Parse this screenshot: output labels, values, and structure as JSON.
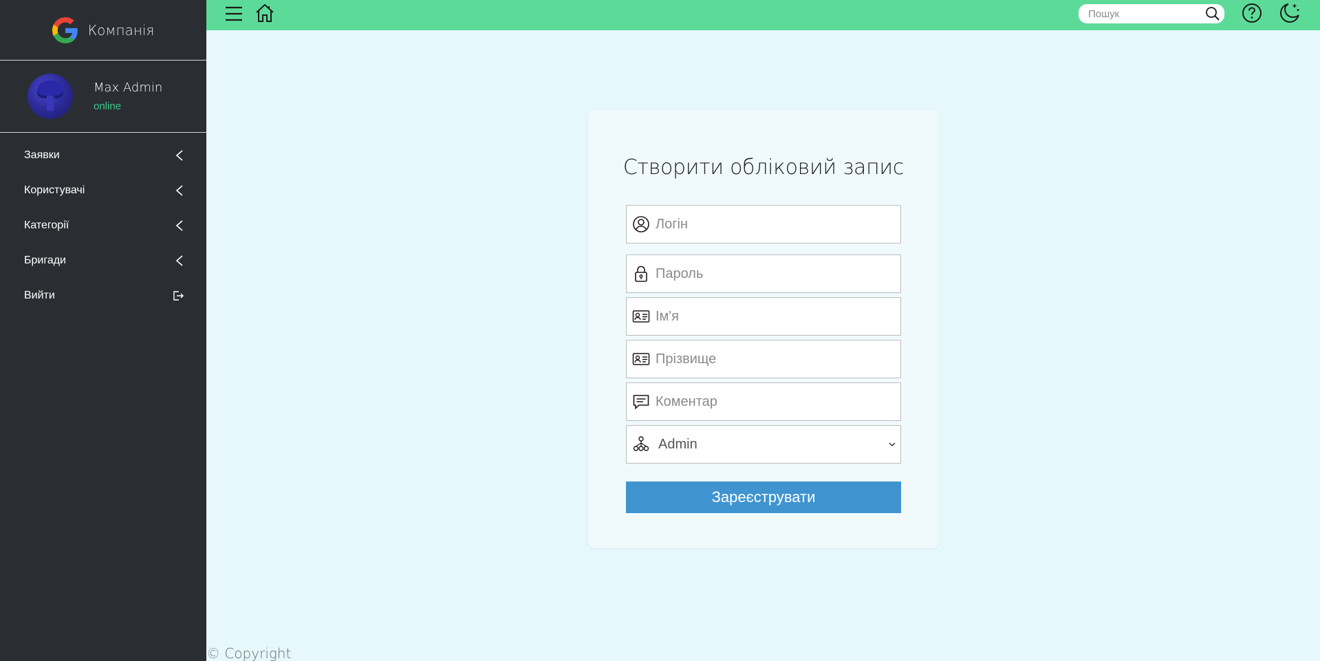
{
  "brand": {
    "name": "Компанія"
  },
  "user": {
    "name": "Max Admin",
    "status": "online"
  },
  "sidebar": {
    "items": [
      {
        "label": "Заявки",
        "icon": "chevron-left-icon"
      },
      {
        "label": "Користувачі",
        "icon": "chevron-left-icon"
      },
      {
        "label": "Категорії",
        "icon": "chevron-left-icon"
      },
      {
        "label": "Бригади",
        "icon": "chevron-left-icon"
      },
      {
        "label": "Вийти",
        "icon": "logout-icon"
      }
    ]
  },
  "topbar": {
    "search_placeholder": "Пошук"
  },
  "form": {
    "title": "Створити обліковий запис",
    "login_placeholder": "Логін",
    "password_placeholder": "Пароль",
    "first_name_placeholder": "Ім'я",
    "last_name_placeholder": "Прізвище",
    "comment_placeholder": "Коментар",
    "role_selected": "Admin",
    "submit_label": "Зареєструвати"
  },
  "footer": {
    "copyright": "© Copyright"
  },
  "colors": {
    "topbar": "#5cdb98",
    "sidebar": "#2a2e33",
    "page_bg": "#e6f8fc",
    "button": "#3f94d0",
    "status_online": "#3ec98a"
  }
}
